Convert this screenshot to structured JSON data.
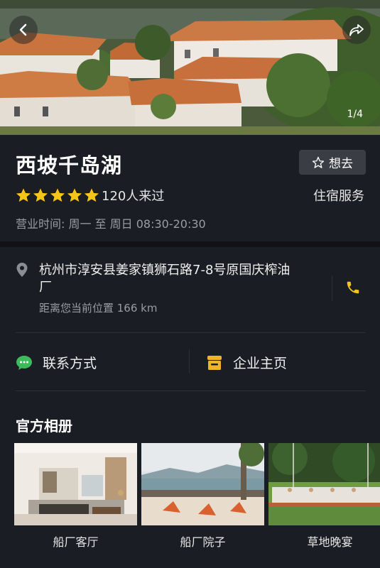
{
  "hero": {
    "pager": "1/4",
    "back_icon": "chevron-left-icon",
    "share_icon": "share-icon"
  },
  "place": {
    "name": "西坡千岛湖",
    "want_label": "想去",
    "rating": 5,
    "visited": "120人来过",
    "category": "住宿服务",
    "hours": "营业时间: 周一 至 周日  08:30-20:30"
  },
  "address": {
    "text": "杭州市淳安县姜家镇狮石路7-8号原国庆榨油厂",
    "distance": "距离您当前位置 166 km"
  },
  "actions": {
    "contact_label": "联系方式",
    "company_label": "企业主页"
  },
  "album": {
    "title": "官方相册",
    "photos": [
      {
        "caption": "船厂客厅"
      },
      {
        "caption": "船厂院子"
      },
      {
        "caption": "草地晚宴"
      }
    ]
  },
  "colors": {
    "background": "#1a1d23",
    "star": "#f5c518",
    "phone": "#f5c518",
    "chat_green": "#3dbb5c",
    "store_yellow": "#f0b429"
  }
}
